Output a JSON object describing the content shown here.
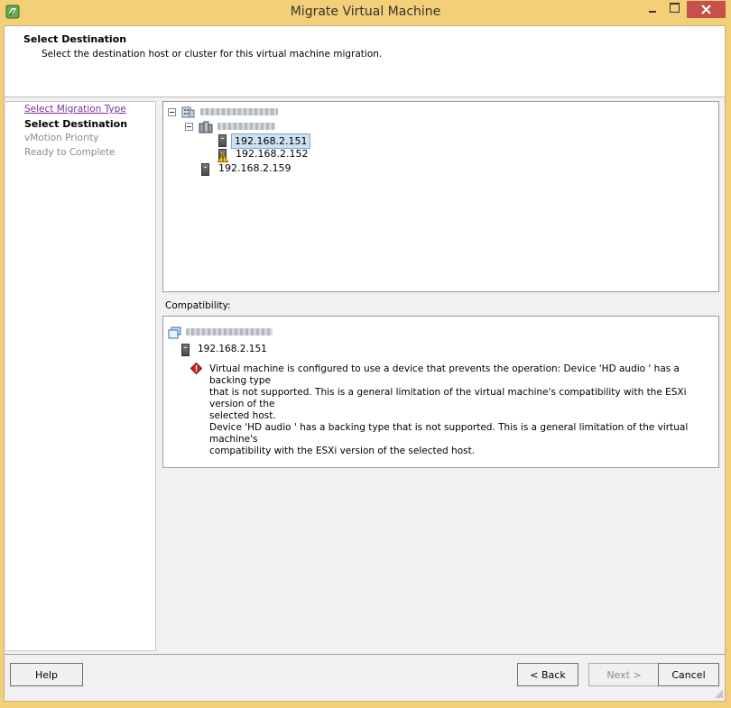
{
  "window": {
    "title": "Migrate Virtual Machine"
  },
  "header": {
    "title": "Select Destination",
    "subtitle": "Select the destination host or cluster for this virtual machine migration."
  },
  "nav": {
    "items": [
      {
        "label": "Select Migration Type",
        "state": "visited-link"
      },
      {
        "label": "Select Destination",
        "state": "current"
      },
      {
        "label": "vMotion Priority",
        "state": "disabled"
      },
      {
        "label": "Ready to Complete",
        "state": "disabled"
      }
    ]
  },
  "tree": {
    "hosts": [
      {
        "label": "192.168.2.151",
        "selected": true,
        "warning": false,
        "icon": "server-icon"
      },
      {
        "label": "192.168.2.152",
        "selected": false,
        "warning": true,
        "icon": "server-warning-icon"
      },
      {
        "label": "192.168.2.159",
        "selected": false,
        "warning": false,
        "icon": "server-icon"
      }
    ]
  },
  "compatibility": {
    "label": "Compatibility:",
    "host": "192.168.2.151",
    "error": "Virtual machine is configured to use a device that prevents the operation: Device 'HD audio ' has a backing type\nthat is not supported. This is a general limitation of the virtual machine's compatibility with the ESXi version of the\nselected host.\nDevice 'HD audio ' has a backing type that is not supported. This is a general limitation of the virtual machine's\ncompatibility with the ESXi version of the selected host."
  },
  "buttons": {
    "help": "Help",
    "back": "< Back",
    "next": "Next >",
    "cancel": "Cancel"
  },
  "colors": {
    "title_bar": "#f4cf79",
    "close_button": "#c7504b",
    "selection": "#cfe0f1",
    "link_visited": "#7b2ca0",
    "error": "#cc2222",
    "warning": "#f2c200"
  }
}
